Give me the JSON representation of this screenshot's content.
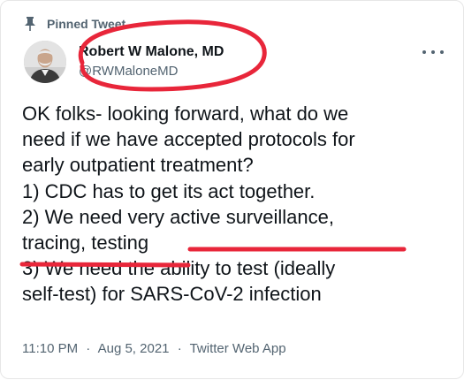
{
  "pinned": {
    "label": "Pinned Tweet",
    "icon": "pin-icon"
  },
  "author": {
    "name": "Robert W Malone, MD",
    "handle": "@RWMaloneMD",
    "avatar_icon": "avatar-photo"
  },
  "menu": {
    "icon": "more-icon"
  },
  "tweet": {
    "lines": [
      "OK folks- looking forward, what do we",
      "need if we have accepted protocols for",
      "early outpatient treatment?",
      "1) CDC has to get its act together.",
      "2) We need very active surveillance,",
      "tracing, testing",
      "3) We need the ability to test (ideally",
      "self-test) for SARS-CoV-2 infection"
    ]
  },
  "meta": {
    "time": "11:10 PM",
    "separator": "·",
    "date": "Aug 5, 2021",
    "source": "Twitter Web App"
  },
  "colors": {
    "text": "#0f1419",
    "secondary": "#536471",
    "marker": "#e8263a"
  }
}
